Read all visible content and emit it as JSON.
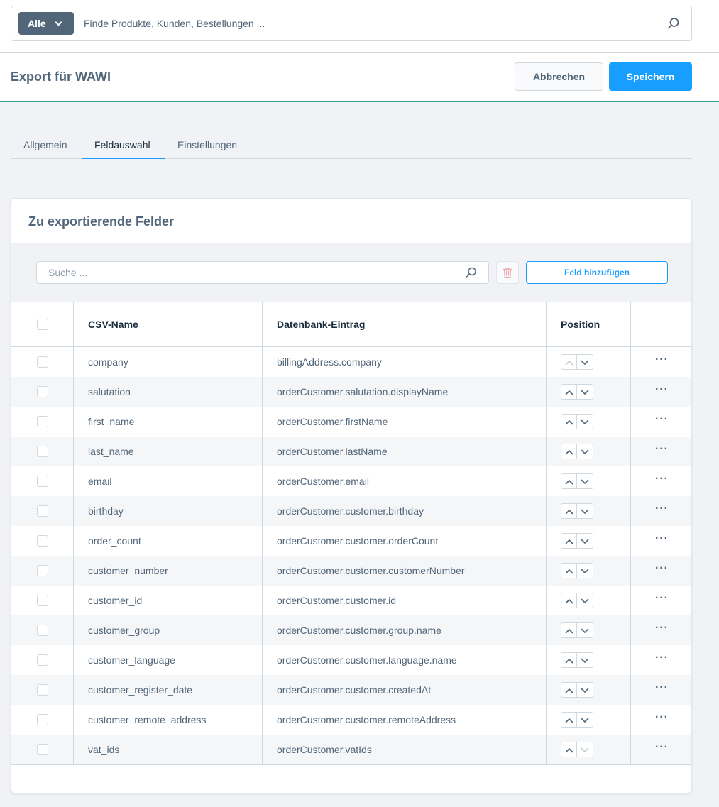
{
  "topbar": {
    "scope_label": "Alle",
    "search_placeholder": "Finde Produkte, Kunden, Bestellungen ..."
  },
  "header": {
    "title": "Export für WAWI",
    "cancel_label": "Abbrechen",
    "save_label": "Speichern"
  },
  "tabs": [
    {
      "label": "Allgemein",
      "active": false
    },
    {
      "label": "Feldauswahl",
      "active": true
    },
    {
      "label": "Einstellungen",
      "active": false
    }
  ],
  "card": {
    "title": "Zu exportierende Felder",
    "search_placeholder": "Suche ...",
    "add_label": "Feld hinzufügen"
  },
  "grid": {
    "columns": {
      "csv_name": "CSV-Name",
      "db_entry": "Datenbank-Eintrag",
      "position": "Position"
    },
    "rows": [
      {
        "csv": "company",
        "db": "billingAddress.company",
        "up_disabled": true,
        "down_disabled": false
      },
      {
        "csv": "salutation",
        "db": "orderCustomer.salutation.displayName",
        "up_disabled": false,
        "down_disabled": false
      },
      {
        "csv": "first_name",
        "db": "orderCustomer.firstName",
        "up_disabled": false,
        "down_disabled": false
      },
      {
        "csv": "last_name",
        "db": "orderCustomer.lastName",
        "up_disabled": false,
        "down_disabled": false
      },
      {
        "csv": "email",
        "db": "orderCustomer.email",
        "up_disabled": false,
        "down_disabled": false
      },
      {
        "csv": "birthday",
        "db": "orderCustomer.customer.birthday",
        "up_disabled": false,
        "down_disabled": false
      },
      {
        "csv": "order_count",
        "db": "orderCustomer.customer.orderCount",
        "up_disabled": false,
        "down_disabled": false
      },
      {
        "csv": "customer_number",
        "db": "orderCustomer.customer.customerNumber",
        "up_disabled": false,
        "down_disabled": false
      },
      {
        "csv": "customer_id",
        "db": "orderCustomer.customer.id",
        "up_disabled": false,
        "down_disabled": false
      },
      {
        "csv": "customer_group",
        "db": "orderCustomer.customer.group.name",
        "up_disabled": false,
        "down_disabled": false
      },
      {
        "csv": "customer_language",
        "db": "orderCustomer.customer.language.name",
        "up_disabled": false,
        "down_disabled": false
      },
      {
        "csv": "customer_register_date",
        "db": "orderCustomer.customer.createdAt",
        "up_disabled": false,
        "down_disabled": false
      },
      {
        "csv": "customer_remote_address",
        "db": "orderCustomer.customer.remoteAddress",
        "up_disabled": false,
        "down_disabled": false
      },
      {
        "csv": "vat_ids",
        "db": "orderCustomer.vatIds",
        "up_disabled": false,
        "down_disabled": true
      }
    ]
  },
  "colors": {
    "primary": "#189eff",
    "text": "#52667a",
    "border": "#d1d9e0",
    "background": "#f0f2f5"
  }
}
